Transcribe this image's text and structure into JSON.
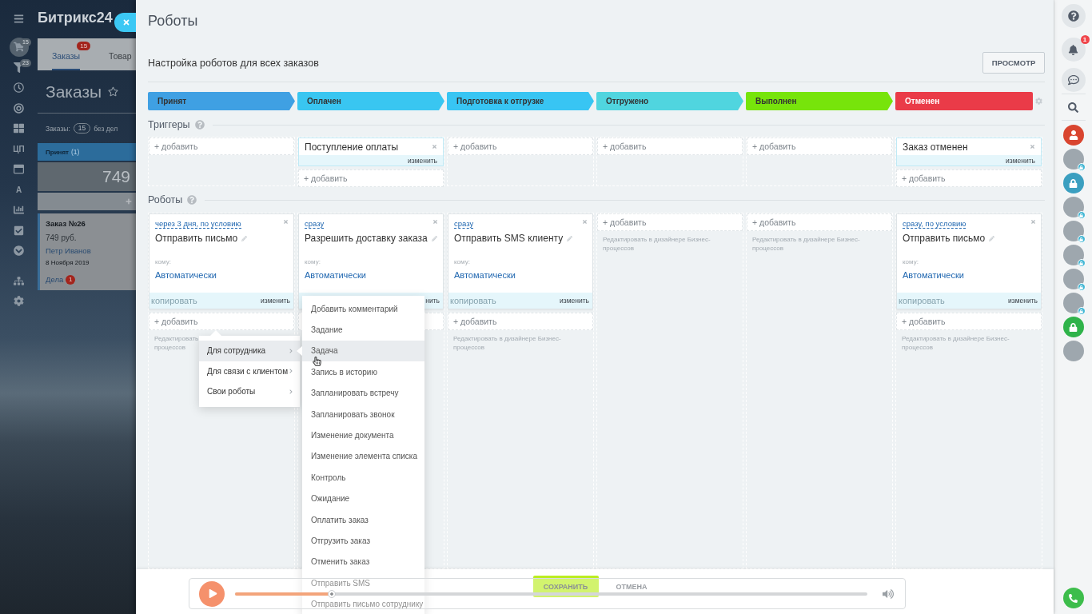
{
  "background_app": {
    "logo": "Битрикс24",
    "nav_items": [
      {
        "kind": "cart",
        "badge": "15",
        "selected": true
      },
      {
        "kind": "filter",
        "badge": "23",
        "selected": false
      },
      {
        "kind": "clock",
        "selected": false
      },
      {
        "kind": "target",
        "selected": false
      },
      {
        "kind": "grid",
        "selected": false
      },
      {
        "kind": "text",
        "label": "ЦП",
        "selected": false
      },
      {
        "kind": "window",
        "selected": false
      },
      {
        "kind": "text",
        "label": "A",
        "selected": false
      },
      {
        "kind": "chart",
        "selected": false
      },
      {
        "kind": "task",
        "selected": false
      },
      {
        "kind": "more",
        "selected": false
      }
    ],
    "nav_bottom_items": [
      {
        "kind": "sitemap",
        "selected": false
      },
      {
        "kind": "settings",
        "selected": false
      }
    ],
    "tabs": [
      {
        "label": "Заказы",
        "badge": "15",
        "selected": true
      },
      {
        "label": "Товар",
        "selected": false
      }
    ],
    "page_title": "Заказы",
    "counter": {
      "label": "Заказы:",
      "count": "15",
      "suffix": "без дел"
    },
    "column": {
      "title": "Принят",
      "count": "(1)",
      "total": "749"
    },
    "card": {
      "title": "Заказ №26",
      "price": "749 руб.",
      "client": "Петр Иванов",
      "date": "8 Ноября 2019",
      "activities": "Дела",
      "activities_count": "1"
    }
  },
  "slider": {
    "title": "Роботы",
    "subtitle": "Настройка роботов для всех заказов",
    "preview_button": "ПРОСМОТР",
    "stages": [
      {
        "label": "Принят",
        "color": "#3fa0e3"
      },
      {
        "label": "Оплачен",
        "color": "#39c6f1"
      },
      {
        "label": "Подготовка к отгрузке",
        "color": "#38c5f3"
      },
      {
        "label": "Отгружено",
        "color": "#50d5df"
      },
      {
        "label": "Выполнен",
        "color": "#77e40b"
      },
      {
        "label": "Отменен",
        "color": "#ea3b48"
      }
    ],
    "triggers": {
      "heading": "Триггеры",
      "columns": [
        {
          "add": "+ добавить"
        },
        {
          "items": [
            {
              "title": "Поступление оплаты",
              "edit": "изменить"
            }
          ],
          "add": "+ добавить"
        },
        {
          "add": "+ добавить"
        },
        {
          "add": "+ добавить"
        },
        {
          "add": "+ добавить"
        },
        {
          "items": [
            {
              "title": "Заказ отменен",
              "edit": "изменить"
            }
          ],
          "add": "+ добавить"
        }
      ]
    },
    "robots": {
      "heading": "Роботы",
      "columns": [
        {
          "items": [
            {
              "condition": "через 3 дня, по условию",
              "title": "Отправить письмо",
              "to_label": "кому:",
              "to_value": "Автоматически",
              "copy": {
                "label": "копировать",
                "disabled": true
              },
              "edit": "изменить"
            }
          ],
          "add": "+ добавить",
          "hint_fragments": [
            "Редактировать",
            "процессов"
          ]
        },
        {
          "items": [
            {
              "condition": "сразу",
              "title": "Разрешить доставку заказа",
              "to_label": "кому:",
              "to_value": "Автоматически",
              "edit": "нить"
            }
          ]
        },
        {
          "items": [
            {
              "condition": "сразу",
              "title": "Отправить SMS клиенту",
              "to_label": "кому:",
              "to_value": "Автоматически",
              "copy": {
                "label": "копировать",
                "disabled": true
              },
              "edit": "изменить"
            }
          ],
          "add": "+ добавить",
          "hint": "Редактировать в дизайнере Бизнес-процессов"
        },
        {
          "add": "+ добавить",
          "hint": "Редактировать в дизайнере Бизнес-процессов"
        },
        {
          "add": "+ добавить",
          "hint": "Редактировать в дизайнере Бизнес-процессов"
        },
        {
          "items": [
            {
              "condition": "сразу, по условию",
              "title": "Отправить письмо",
              "to_label": "кому:",
              "to_value": "Автоматически",
              "copy": {
                "label": "копировать",
                "disabled": true
              },
              "edit": "изменить"
            }
          ],
          "add": "+ добавить",
          "hint": "Редактировать в дизайнере Бизнес-процессов"
        }
      ]
    },
    "footer": {
      "save": "СОХРАНИТЬ",
      "cancel": "ОТМЕНА"
    }
  },
  "add_menu": {
    "items": [
      {
        "label": "Для сотрудника",
        "selected": true
      },
      {
        "label": "Для связи с клиентом",
        "selected": false
      },
      {
        "label": "Свои роботы",
        "selected": false
      }
    ]
  },
  "robot_submenu": {
    "items": [
      {
        "label": "Добавить комментарий",
        "selected": false
      },
      {
        "label": "Задание",
        "selected": false
      },
      {
        "label": "Задача",
        "selected": true
      },
      {
        "label": "Запись в историю",
        "selected": false
      },
      {
        "label": "Запланировать встречу",
        "selected": false
      },
      {
        "label": "Запланировать звонок",
        "selected": false
      },
      {
        "label": "Изменение документа",
        "selected": false
      },
      {
        "label": "Изменение элемента списка",
        "selected": false
      },
      {
        "label": "Контроль",
        "selected": false
      },
      {
        "label": "Ожидание",
        "selected": false
      },
      {
        "label": "Оплатить заказ",
        "selected": false
      },
      {
        "label": "Отгрузить заказ",
        "selected": false
      },
      {
        "label": "Отменить заказ",
        "selected": false
      },
      {
        "label": "Отправить SMS",
        "selected": false
      },
      {
        "label": "Отправить письмо сотруднику",
        "selected": false
      }
    ]
  },
  "right_bar": {
    "notifications": "1",
    "avatars": [
      {
        "kind": "user",
        "color": "#d9452f"
      },
      {
        "kind": "photo",
        "locked": true
      },
      {
        "kind": "lock",
        "color": "#3b9fc0"
      },
      {
        "kind": "photo",
        "locked": true
      },
      {
        "kind": "photo",
        "locked": true
      },
      {
        "kind": "photo",
        "locked": true
      },
      {
        "kind": "photo",
        "locked": true
      },
      {
        "kind": "photo",
        "locked": true
      },
      {
        "kind": "lock",
        "color": "#2fb34a"
      },
      {
        "kind": "photo",
        "locked": false
      }
    ]
  },
  "player": {
    "level": 0.153
  }
}
